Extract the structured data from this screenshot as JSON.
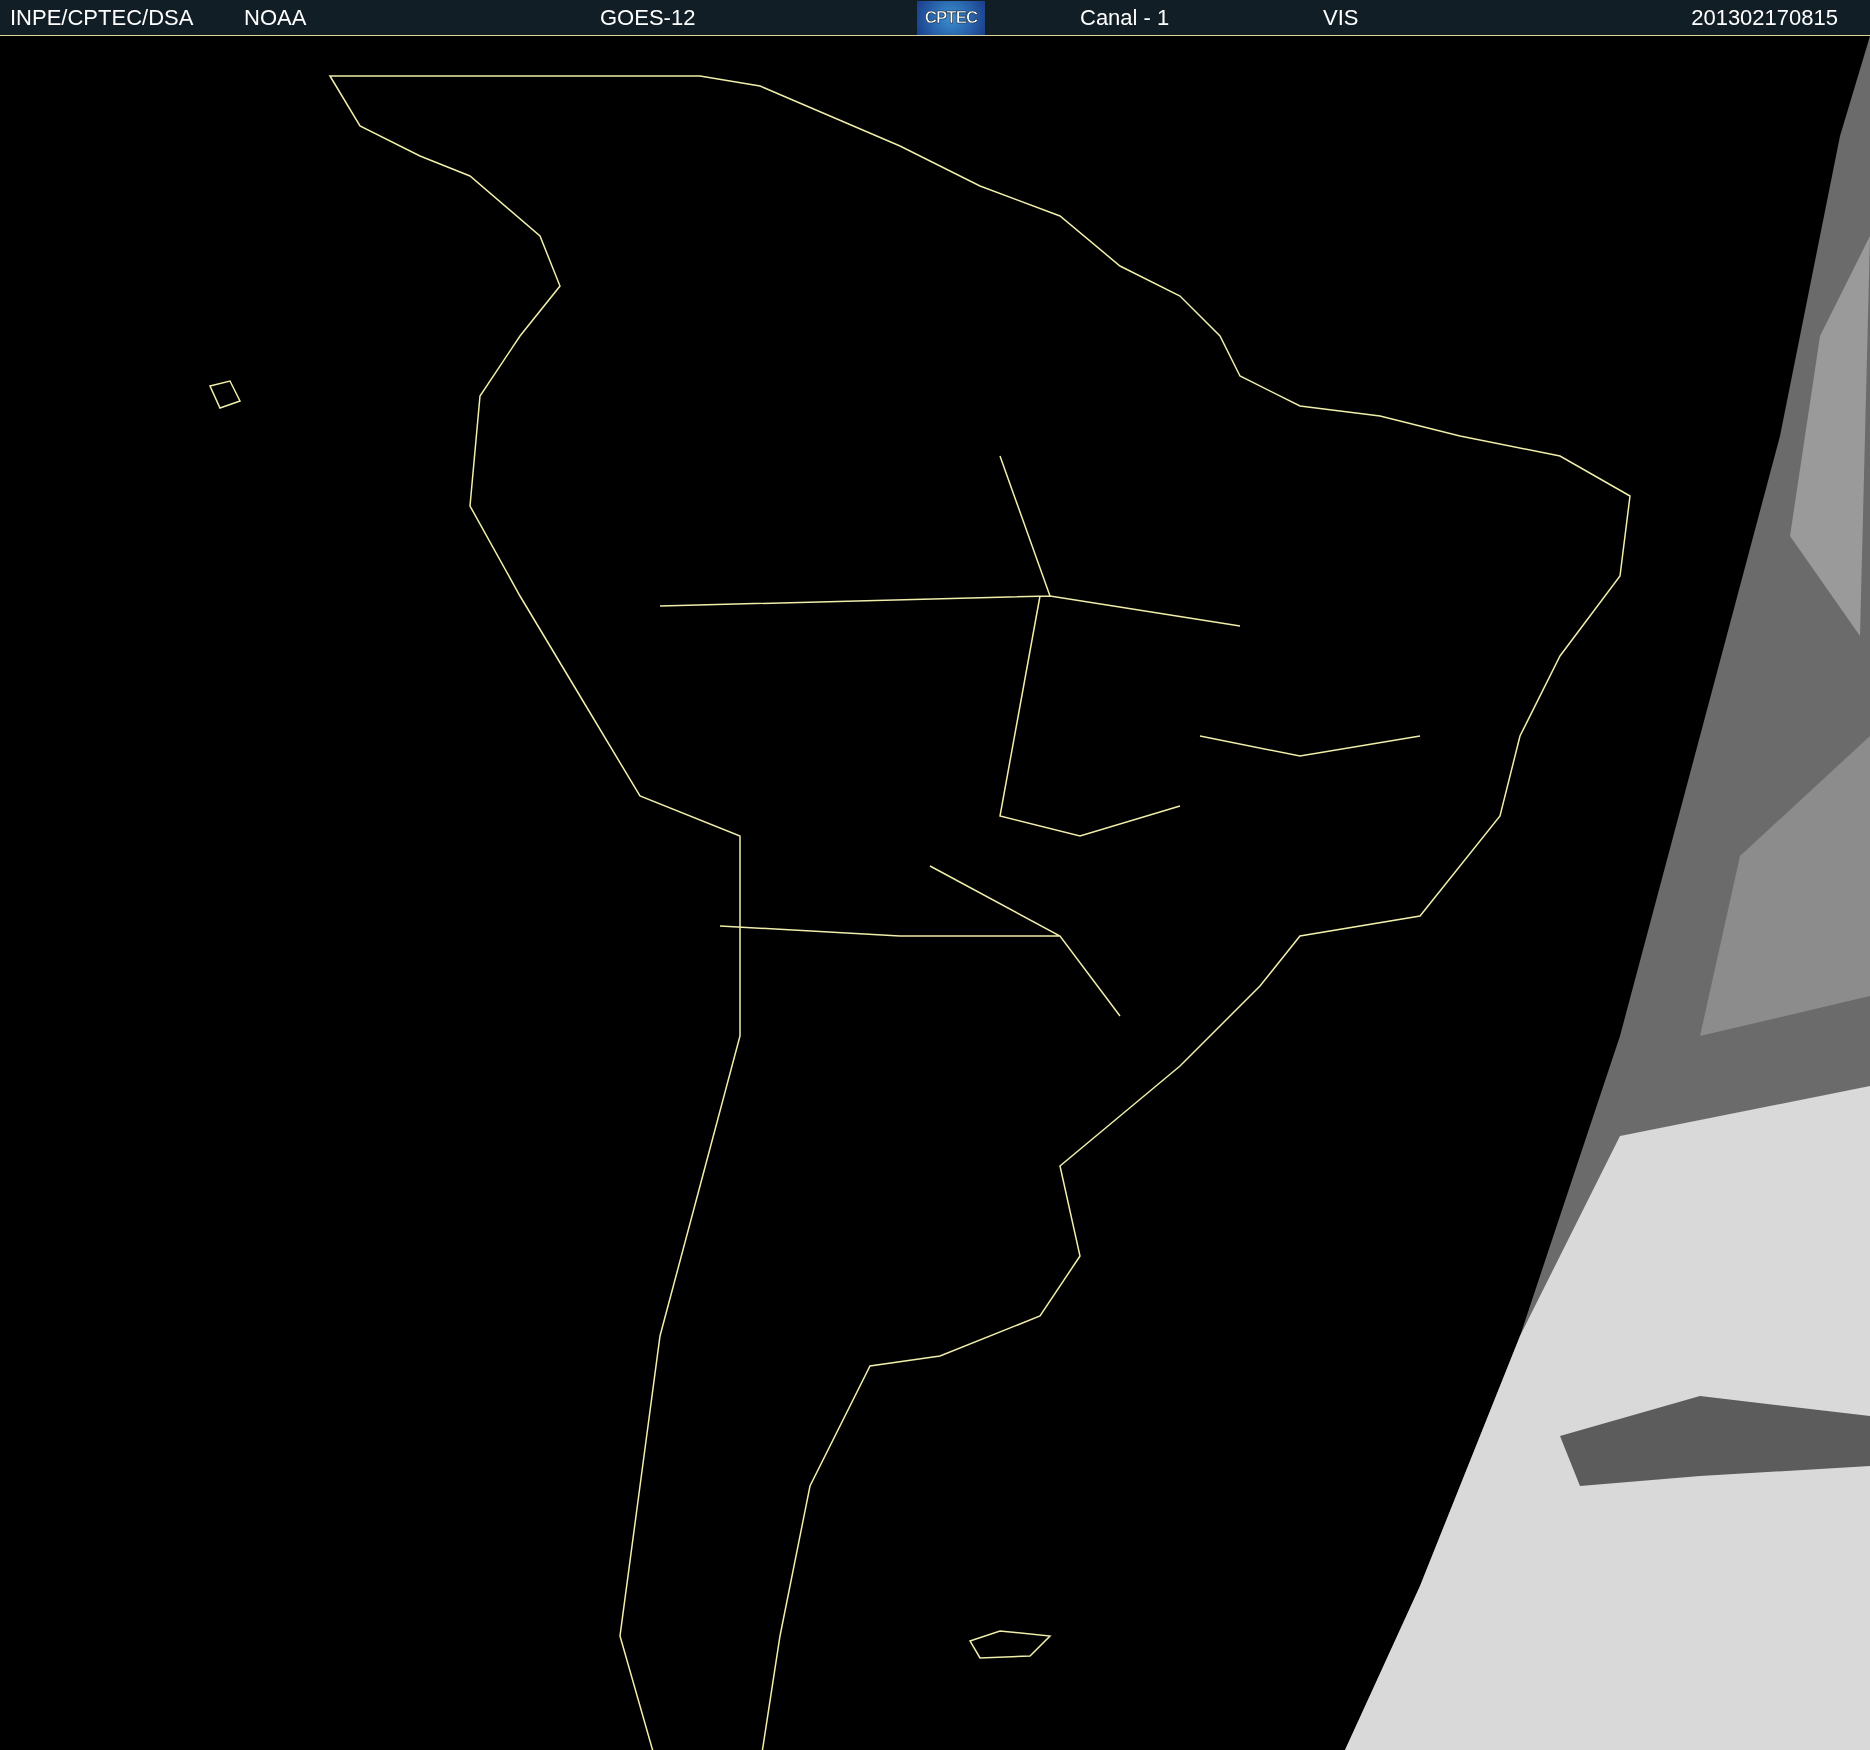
{
  "header": {
    "source": "INPE/CPTEC/DSA",
    "agency": "NOAA",
    "satellite": "GOES-12",
    "logo": "CPTEC",
    "channel": "Canal - 1",
    "band": "VIS",
    "timestamp": "201302170815"
  }
}
